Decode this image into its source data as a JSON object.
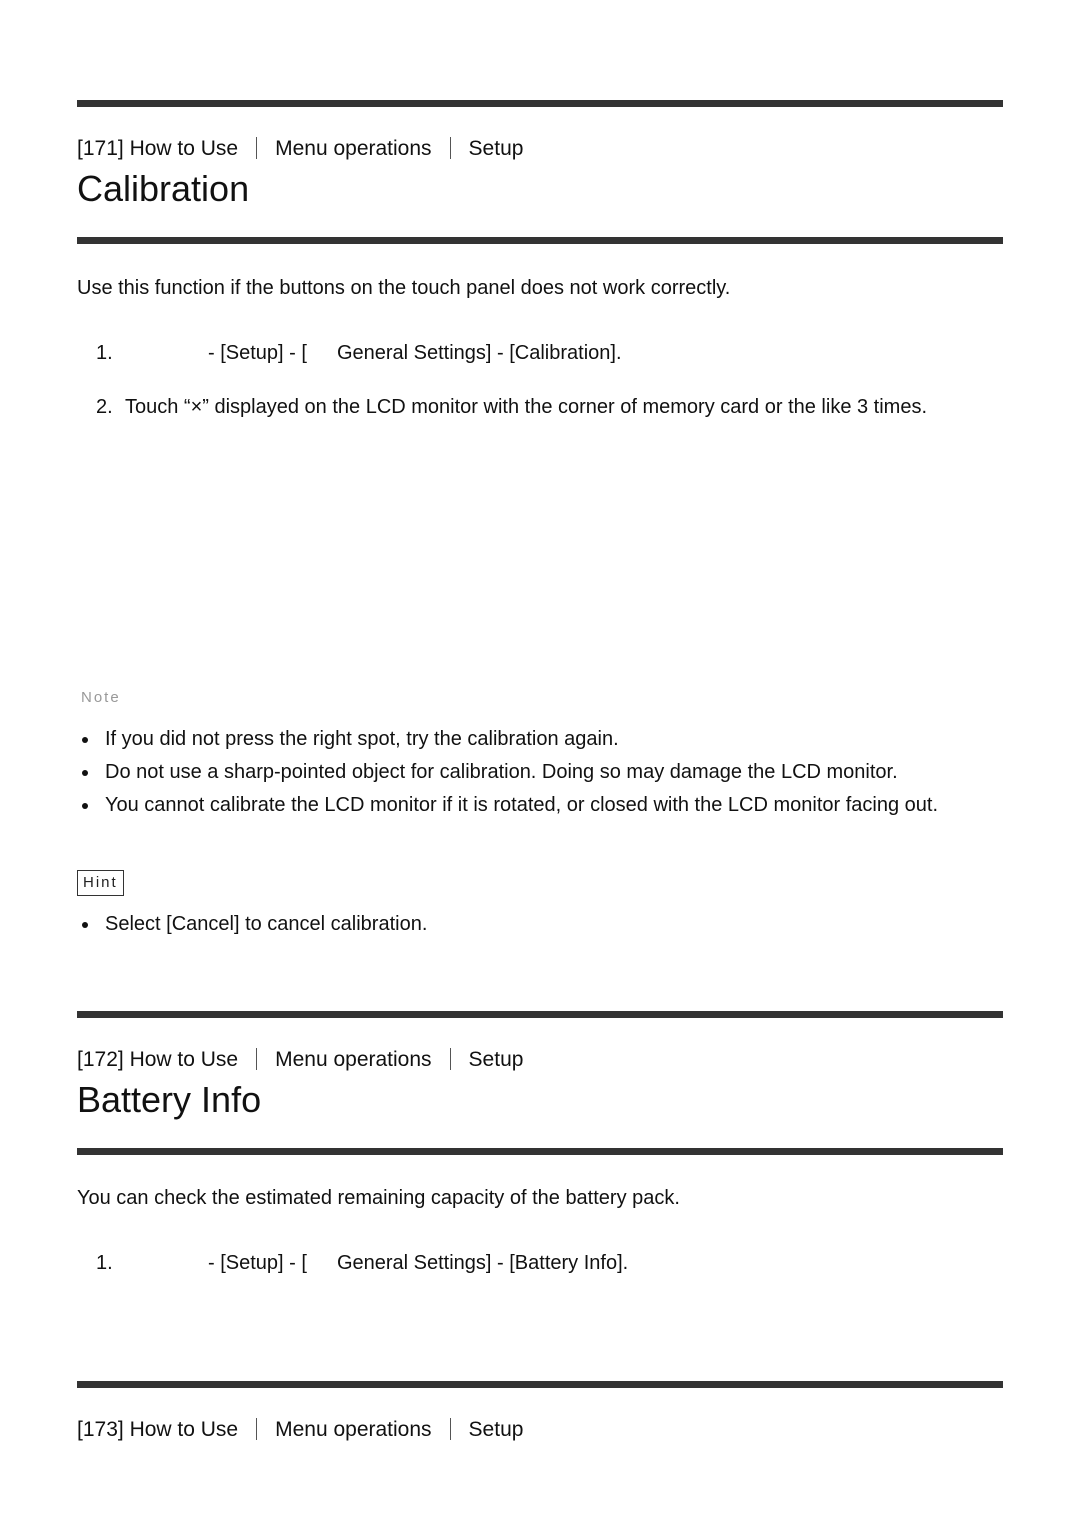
{
  "sections": [
    {
      "breadcrumb": {
        "number": "[171]",
        "items": [
          "How to Use",
          "Menu operations",
          "Setup"
        ]
      },
      "title": "Calibration",
      "intro": "Use this function if the buttons on the touch panel does not work correctly.",
      "steps": [
        {
          "num": "1.",
          "parts": [
            "- [Setup] - [",
            "General Settings] - [Calibration]."
          ]
        },
        {
          "num": "2.",
          "text": "Touch “×” displayed on the LCD monitor with the corner of memory card or the like 3 times."
        }
      ],
      "note_label": "Note",
      "notes": [
        "If you did not press the right spot, try the calibration again.",
        "Do not use a sharp-pointed object for calibration. Doing so may damage the LCD monitor.",
        "You cannot calibrate the LCD monitor if it is rotated, or closed with the LCD monitor facing out."
      ],
      "hint_label": "Hint",
      "hints": [
        "Select [Cancel] to cancel calibration."
      ]
    },
    {
      "breadcrumb": {
        "number": "[172]",
        "items": [
          "How to Use",
          "Menu operations",
          "Setup"
        ]
      },
      "title": "Battery Info",
      "intro": "You can check the estimated remaining capacity of the battery pack.",
      "steps": [
        {
          "num": "1.",
          "parts": [
            "- [Setup] - [",
            "General Settings] - [Battery Info]."
          ]
        }
      ]
    },
    {
      "breadcrumb": {
        "number": "[173]",
        "items": [
          "How to Use",
          "Menu operations",
          "Setup"
        ]
      }
    }
  ]
}
